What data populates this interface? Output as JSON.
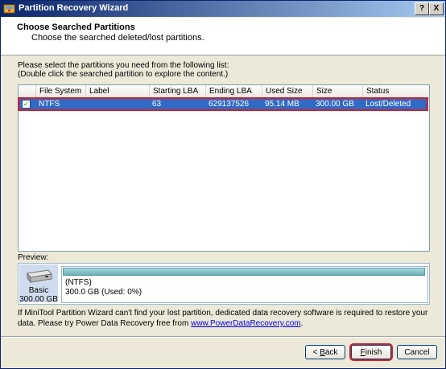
{
  "window": {
    "title": "Partition Recovery Wizard",
    "help_btn": "?",
    "close_btn": "X"
  },
  "header": {
    "title": "Choose Searched Partitions",
    "subtitle": "Choose the searched deleted/lost partitions."
  },
  "instructions": {
    "line1": "Please select the partitions you need from the following list:",
    "line2": "(Double click the searched partition to explore the content.)"
  },
  "table": {
    "columns": [
      "File System",
      "Label",
      "Starting LBA",
      "Ending LBA",
      "Used Size",
      "Size",
      "Status"
    ],
    "rows": [
      {
        "checked": true,
        "file_system": "NTFS",
        "label": "",
        "starting_lba": "63",
        "ending_lba": "629137526",
        "used_size": "95.14 MB",
        "size": "300.00 GB",
        "status": "Lost/Deleted"
      }
    ]
  },
  "preview": {
    "label": "Preview:",
    "disk_type": "Basic",
    "disk_size": "300.00 GB",
    "partition_name": "(NTFS)",
    "partition_info": "300.0 GB (Used: 0%)"
  },
  "note": {
    "text1": "If MiniTool Partition Wizard can't find your lost partition, dedicated data recovery software is required to restore your data. Please try Power Data Recovery free from ",
    "link": "www.PowerDataRecovery.com",
    "text2": "."
  },
  "buttons": {
    "back_prefix": "< ",
    "back_mnemonic": "B",
    "back_rest": "ack",
    "finish_mnemonic": "F",
    "finish_rest": "inish",
    "cancel": "Cancel"
  },
  "colors": {
    "selection": "#316ac5",
    "highlight_border": "#d0202a"
  }
}
